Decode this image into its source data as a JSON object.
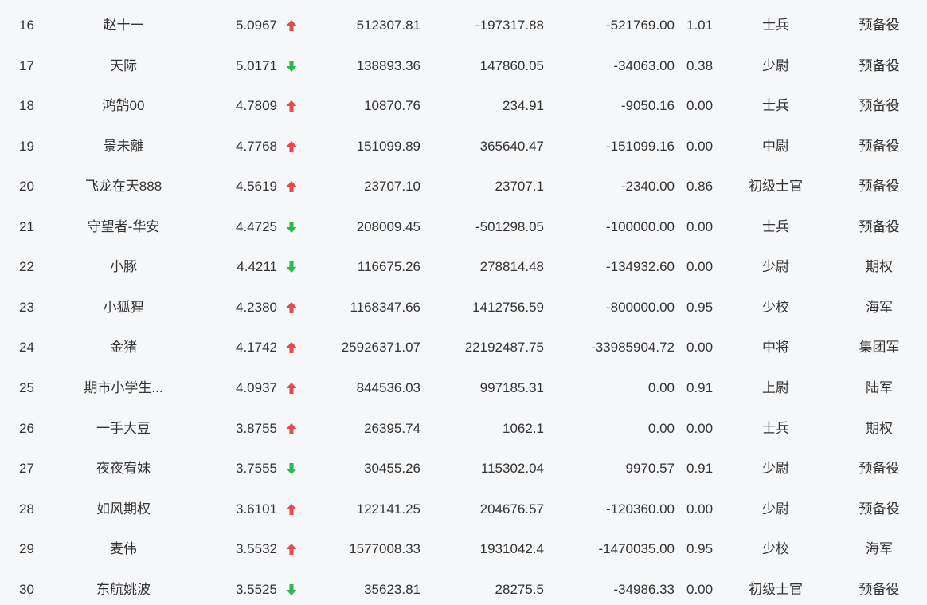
{
  "colors": {
    "up": "#e84a4a",
    "down": "#2ab84a",
    "background": "#f6f7f9",
    "text": "#333333"
  },
  "rows": [
    {
      "rank": "16",
      "name": "赵十一",
      "score": "5.0967",
      "trend": "up",
      "v1": "512307.81",
      "v2": "-197317.88",
      "v3": "-521769.00",
      "ratio": "1.01",
      "level": "士兵",
      "group": "预备役"
    },
    {
      "rank": "17",
      "name": "天际",
      "score": "5.0171",
      "trend": "down",
      "v1": "138893.36",
      "v2": "147860.05",
      "v3": "-34063.00",
      "ratio": "0.38",
      "level": "少尉",
      "group": "预备役"
    },
    {
      "rank": "18",
      "name": "鸿鹄00",
      "score": "4.7809",
      "trend": "up",
      "v1": "10870.76",
      "v2": "234.91",
      "v3": "-9050.16",
      "ratio": "0.00",
      "level": "士兵",
      "group": "预备役"
    },
    {
      "rank": "19",
      "name": "景未離",
      "score": "4.7768",
      "trend": "up",
      "v1": "151099.89",
      "v2": "365640.47",
      "v3": "-151099.16",
      "ratio": "0.00",
      "level": "中尉",
      "group": "预备役"
    },
    {
      "rank": "20",
      "name": "飞龙在天888",
      "score": "4.5619",
      "trend": "up",
      "v1": "23707.10",
      "v2": "23707.1",
      "v3": "-2340.00",
      "ratio": "0.86",
      "level": "初级士官",
      "group": "预备役"
    },
    {
      "rank": "21",
      "name": "守望者-华安",
      "score": "4.4725",
      "trend": "down",
      "v1": "208009.45",
      "v2": "-501298.05",
      "v3": "-100000.00",
      "ratio": "0.00",
      "level": "士兵",
      "group": "预备役"
    },
    {
      "rank": "22",
      "name": "小豚",
      "score": "4.4211",
      "trend": "down",
      "v1": "116675.26",
      "v2": "278814.48",
      "v3": "-134932.60",
      "ratio": "0.00",
      "level": "少尉",
      "group": "期权"
    },
    {
      "rank": "23",
      "name": "小狐狸",
      "score": "4.2380",
      "trend": "up",
      "v1": "1168347.66",
      "v2": "1412756.59",
      "v3": "-800000.00",
      "ratio": "0.95",
      "level": "少校",
      "group": "海军"
    },
    {
      "rank": "24",
      "name": "金猪",
      "score": "4.1742",
      "trend": "up",
      "v1": "25926371.07",
      "v2": "22192487.75",
      "v3": "-33985904.72",
      "ratio": "0.00",
      "level": "中将",
      "group": "集团军"
    },
    {
      "rank": "25",
      "name": "期市小学生...",
      "score": "4.0937",
      "trend": "up",
      "v1": "844536.03",
      "v2": "997185.31",
      "v3": "0.00",
      "ratio": "0.91",
      "level": "上尉",
      "group": "陆军"
    },
    {
      "rank": "26",
      "name": "一手大豆",
      "score": "3.8755",
      "trend": "up",
      "v1": "26395.74",
      "v2": "1062.1",
      "v3": "0.00",
      "ratio": "0.00",
      "level": "士兵",
      "group": "期权"
    },
    {
      "rank": "27",
      "name": "夜夜宥妹",
      "score": "3.7555",
      "trend": "down",
      "v1": "30455.26",
      "v2": "115302.04",
      "v3": "9970.57",
      "ratio": "0.91",
      "level": "少尉",
      "group": "预备役"
    },
    {
      "rank": "28",
      "name": "如风期权",
      "score": "3.6101",
      "trend": "up",
      "v1": "122141.25",
      "v2": "204676.57",
      "v3": "-120360.00",
      "ratio": "0.00",
      "level": "少尉",
      "group": "预备役"
    },
    {
      "rank": "29",
      "name": "麦伟",
      "score": "3.5532",
      "trend": "up",
      "v1": "1577008.33",
      "v2": "1931042.4",
      "v3": "-1470035.00",
      "ratio": "0.95",
      "level": "少校",
      "group": "海军"
    },
    {
      "rank": "30",
      "name": "东航姚波",
      "score": "3.5525",
      "trend": "down",
      "v1": "35623.81",
      "v2": "28275.5",
      "v3": "-34986.33",
      "ratio": "0.00",
      "level": "初级士官",
      "group": "预备役"
    }
  ]
}
